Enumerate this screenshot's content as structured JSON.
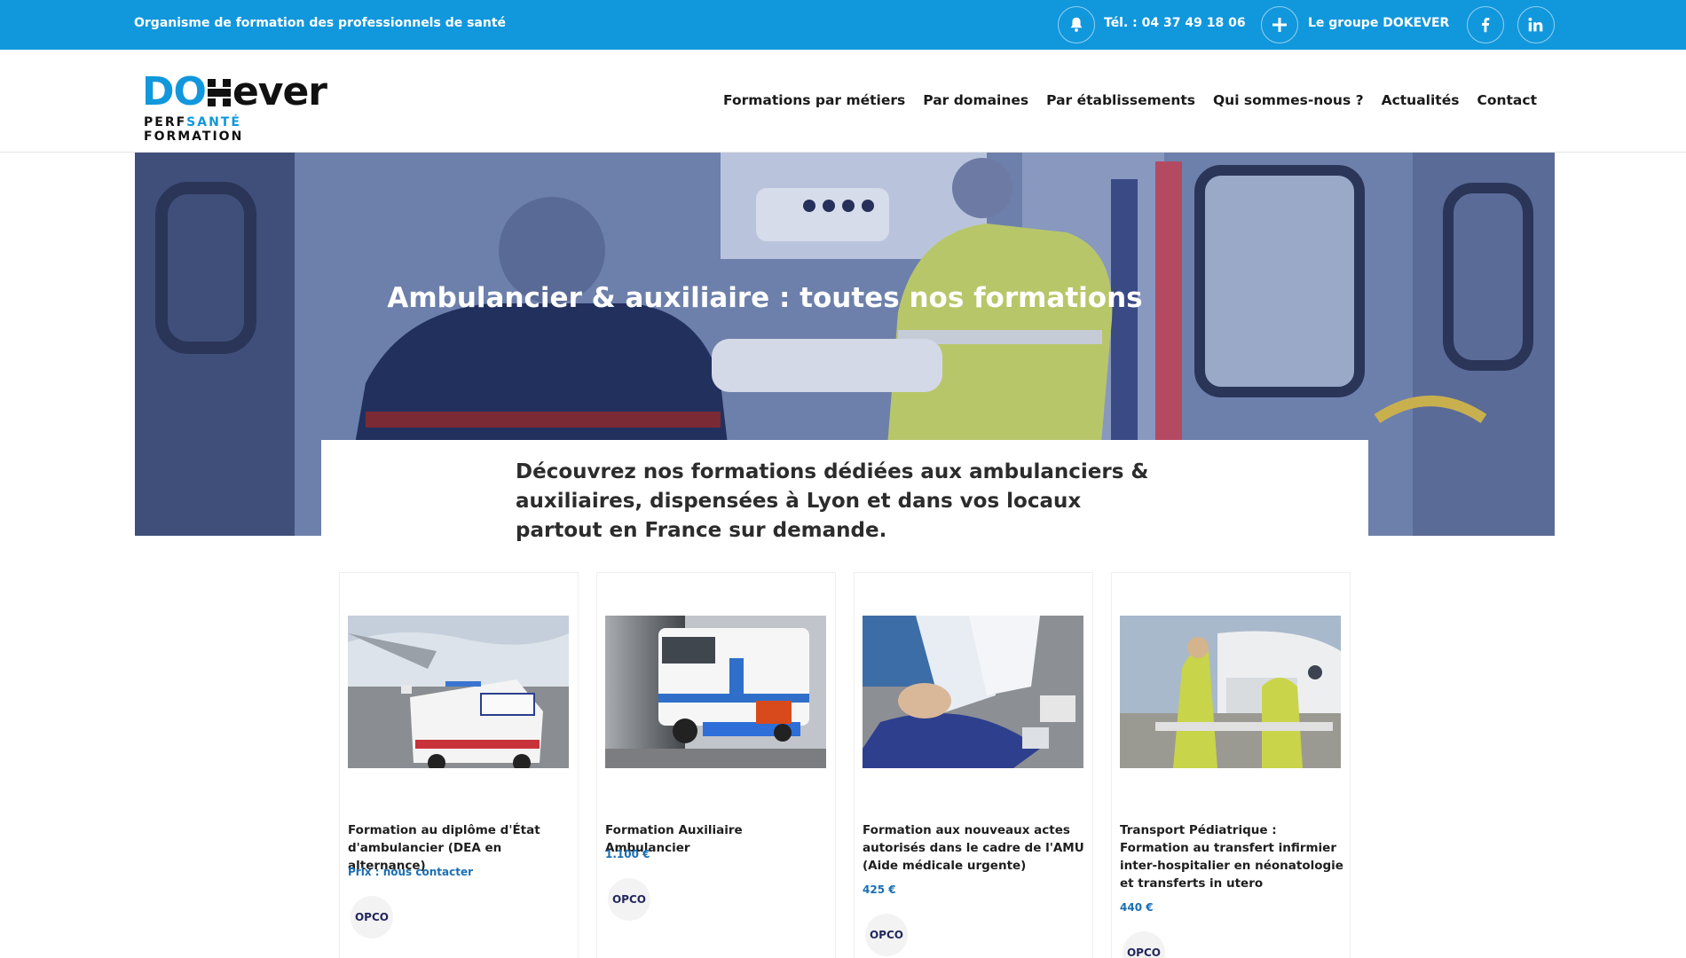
{
  "topbar": {
    "tagline": "Organisme de formation des professionnels de santé",
    "phone": "Tél. : 04 37 49 18 06",
    "group": "Le groupe DOKEVER",
    "icons": [
      "bell-icon",
      "plus-icon",
      "facebook-icon",
      "linkedin-icon"
    ]
  },
  "logo": {
    "do": "DO",
    "kever": "KEVER",
    "ever": "ever",
    "line2a": "PERF",
    "line2b": "SANTÉ",
    "line2c": " FORMATION"
  },
  "nav": [
    "Formations par métiers",
    "Par domaines",
    "Par établissements",
    "Qui sommes-nous ?",
    "Actualités",
    "Contact"
  ],
  "hero": {
    "title": "Ambulancier & auxiliaire : toutes nos formations",
    "intro": "Découvrez nos formations dédiées aux ambulanciers & auxiliaires, dispensées à Lyon et dans vos locaux partout en France sur demande."
  },
  "cards": [
    {
      "title": "Formation au diplôme d'État d'ambulancier (DEA en alternance)",
      "price": "Prix : nous contacter",
      "badge": "OPCO"
    },
    {
      "title": "Formation Auxiliaire Ambulancier",
      "price": "1.100 €",
      "badge": "OPCO"
    },
    {
      "title": "Formation aux nouveaux actes autorisés dans le cadre de l'AMU (Aide médicale urgente)",
      "price": "425 €",
      "badge": "OPCO"
    },
    {
      "title": "Transport Pédiatrique : Formation au transfert infirmier inter-hospitalier en néonatologie et transferts in utero",
      "price": "440 €",
      "badge": "OPCO"
    }
  ],
  "colors": {
    "brand_blue": "#1197dc",
    "price_blue": "#1a6fb3"
  }
}
